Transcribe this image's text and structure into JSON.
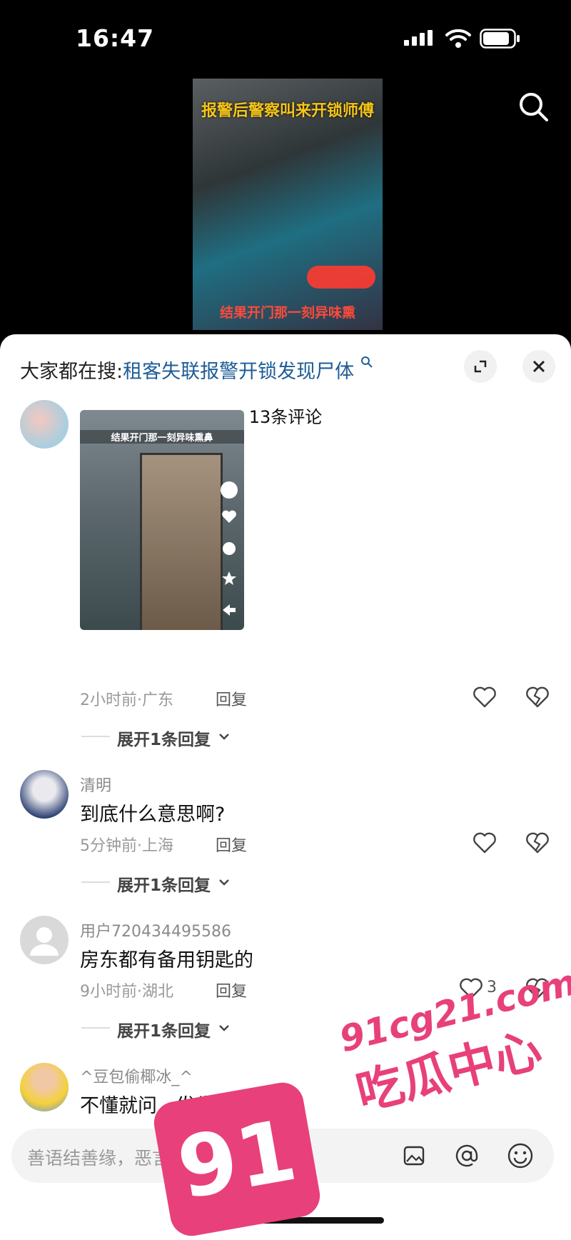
{
  "status_bar": {
    "time": "16:47"
  },
  "video": {
    "caption_top": "报警后警察叫来开锁师傅",
    "caption_bottom": "结果开门那一刻异味熏"
  },
  "sheet": {
    "search_prefix": "大家都在搜:",
    "search_link": "租客失联报警开锁发现尸体",
    "comment_count": "13条评论",
    "comments": [
      {
        "username": "",
        "image_caption": "结果开门那一刻异味熏鼻",
        "time_location": "2小时前·广东",
        "reply_label": "回复",
        "expand_label": "展开1条回复"
      },
      {
        "username": "清明",
        "text": "到底什么意思啊?",
        "time_location": "5分钟前·上海",
        "reply_label": "回复",
        "expand_label": "展开1条回复"
      },
      {
        "username": "用户720434495586",
        "text": "房东都有备用钥匙的",
        "time_location": "9小时前·湖北",
        "reply_label": "回复",
        "like_count": "3",
        "expand_label": "展开1条回复"
      },
      {
        "username": "^豆包偷椰冰_^",
        "text": "不懂就问，发生啥了呀?"
      }
    ],
    "input_placeholder": "善语结善缘，恶言伤人心"
  },
  "watermark": {
    "domain": "91cg21.com",
    "name": "吃瓜中心",
    "logo": "91"
  },
  "colors": {
    "link": "#1e5c96",
    "watermark": "#e8407a"
  }
}
